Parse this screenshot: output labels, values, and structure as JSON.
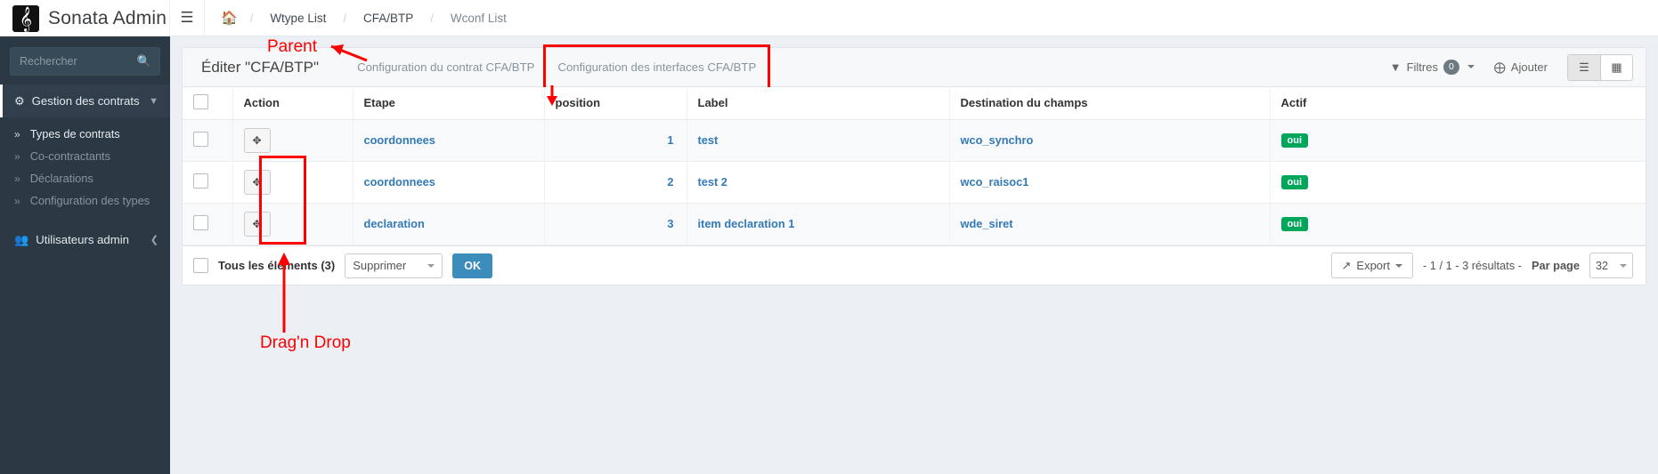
{
  "brand": {
    "name": "Sonata Admin",
    "logo_icon": "music-note-icon"
  },
  "topbar": {
    "menu_toggle_icon": "hamburger-icon",
    "breadcrumb": [
      {
        "label": "",
        "icon": "home-icon"
      },
      {
        "label": "Wtype List"
      },
      {
        "label": "CFA/BTP"
      },
      {
        "label": "Wconf List"
      }
    ],
    "separator": "/"
  },
  "sidebar": {
    "search": {
      "placeholder": "Rechercher",
      "value": "",
      "icon": "search-icon"
    },
    "sections": [
      {
        "label": "Gestion des contrats",
        "icon": "gears-icon",
        "chevron": "chevron-down-icon",
        "items": [
          {
            "label": "Types de contrats",
            "active": true
          },
          {
            "label": "Co-contractants",
            "active": false
          },
          {
            "label": "Déclarations",
            "active": false
          },
          {
            "label": "Configuration des types",
            "active": false
          }
        ]
      },
      {
        "label": "Utilisateurs admin",
        "icon": "users-icon",
        "chevron": "chevron-left-icon",
        "items": []
      }
    ]
  },
  "header": {
    "title": "Éditer \"CFA/BTP\"",
    "tabs": [
      {
        "label": "Configuration du contrat CFA/BTP",
        "highlighted": false
      },
      {
        "label": "Configuration des interfaces CFA/BTP",
        "highlighted": true
      }
    ],
    "filters": {
      "label": "Filtres",
      "count": "0",
      "icon": "filter-icon"
    },
    "add": {
      "label": "Ajouter",
      "icon": "plus-circle-icon"
    },
    "views": [
      {
        "name": "list-view",
        "icon": "list-icon",
        "active": true
      },
      {
        "name": "grid-view",
        "icon": "grid-icon",
        "active": false
      }
    ]
  },
  "table": {
    "columns": [
      "",
      "Action",
      "Etape",
      "position",
      "Label",
      "Destination du champs",
      "Actif"
    ],
    "rows": [
      {
        "etape": "coordonnees",
        "position": "1",
        "label": "test",
        "destination": "wco_synchro",
        "actif": "oui",
        "drag_icon": "arrows-move-icon"
      },
      {
        "etape": "coordonnees",
        "position": "2",
        "label": "test 2",
        "destination": "wco_raisoc1",
        "actif": "oui",
        "drag_icon": "arrows-move-icon"
      },
      {
        "etape": "declaration",
        "position": "3",
        "label": "item declaration 1",
        "destination": "wde_siret",
        "actif": "oui",
        "drag_icon": "arrows-move-icon"
      }
    ]
  },
  "footer": {
    "select_all_label": "Tous les éléments (3)",
    "bulk_action": "Supprimer",
    "ok_label": "OK",
    "export": {
      "label": "Export",
      "icon": "export-icon"
    },
    "pagination": "- 1 / 1 - 3 résultats -",
    "per_page_label": "Par page",
    "per_page_value": "32"
  },
  "annotations": [
    {
      "name": "parent-annotation",
      "text": "Parent"
    },
    {
      "name": "dragndrop-annotation",
      "text": "Drag'n Drop"
    }
  ],
  "colors": {
    "accent": "#3c8dbc",
    "link": "#337ab7",
    "success": "#00a65a",
    "annotation": "#ff0000",
    "sidebar": "#2b3945"
  }
}
